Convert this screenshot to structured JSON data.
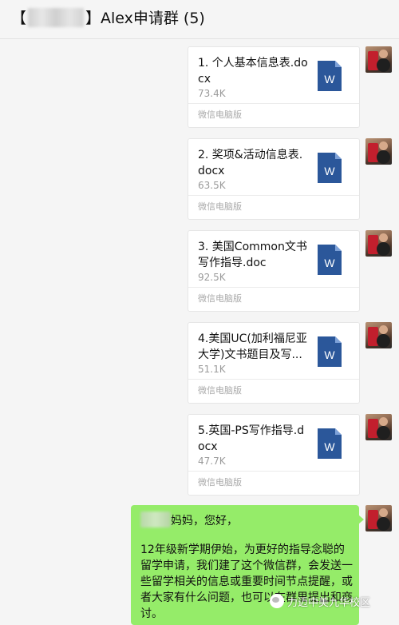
{
  "header": {
    "title_prefix": "【",
    "title_main": "】Alex申请群 (5)"
  },
  "files": [
    {
      "name": "1. 个人基本信息表.docx",
      "size": "73.4K",
      "source": "微信电脑版"
    },
    {
      "name": "2. 奖项&活动信息表.docx",
      "size": "63.5K",
      "source": "微信电脑版"
    },
    {
      "name": "3. 美国Common文书写作指导.doc",
      "size": "92.5K",
      "source": "微信电脑版"
    },
    {
      "name": "4.美国UC(加利福尼亚大学)文书题目及写...",
      "size": "51.1K",
      "source": "微信电脑版"
    },
    {
      "name": "5.英国-PS写作指导.docx",
      "size": "47.7K",
      "source": "微信电脑版"
    }
  ],
  "file_icon_letter": "W",
  "text_message": {
    "greeting": "妈妈，您好，",
    "body": "12年级新学期伊始，为更好的指导念聪的留学申请，我们建了这个微信群，会发送一些留学相关的信息或重要时间节点提醒，或者大家有什么问题，也可以在群里提出和商讨。"
  },
  "watermark": "力迈中美九华校区",
  "colors": {
    "bubble_green": "#95ec69",
    "word_blue": "#2b579a"
  }
}
